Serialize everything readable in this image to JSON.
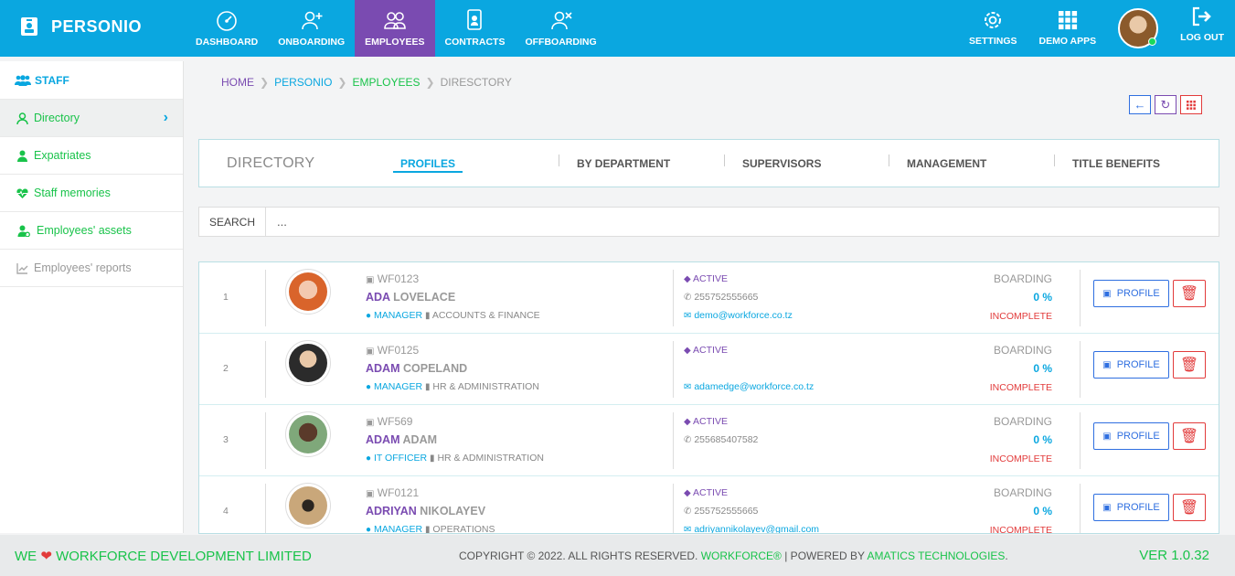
{
  "brand": {
    "name": "PERSONIO"
  },
  "nav": [
    {
      "label": "DASHBOARD"
    },
    {
      "label": "ONBOARDING"
    },
    {
      "label": "EMPLOYEES",
      "active": true
    },
    {
      "label": "CONTRACTS"
    },
    {
      "label": "OFFBOARDING"
    }
  ],
  "right_nav": {
    "settings": "SETTINGS",
    "demo_apps": "DEMO APPS",
    "logout": "LOG OUT"
  },
  "sidebar": {
    "header": "STAFF",
    "items": [
      {
        "label": "Directory",
        "active": true
      },
      {
        "label": "Expatriates"
      },
      {
        "label": "Staff memories"
      },
      {
        "label": "Employees' assets"
      },
      {
        "label": "Employees' reports"
      }
    ]
  },
  "breadcrumb": {
    "home": "HOME",
    "personio": "PERSONIO",
    "employees": "EMPLOYEES",
    "current": "DIRESCTORY"
  },
  "tabs": {
    "title": "DIRECTORY",
    "items": [
      "PROFILES",
      "BY DEPARTMENT",
      "SUPERVISORS",
      "MANAGEMENT",
      "TITLE BENEFITS"
    ]
  },
  "search": {
    "label": "SEARCH",
    "value": "..."
  },
  "employees": [
    {
      "num": "1",
      "code": "WF0123",
      "first": "ADA",
      "last": "LOVELACE",
      "title": "MANAGER",
      "dept": "ACCOUNTS & FINANCE",
      "status": "ACTIVE",
      "phone": "255752555665",
      "email": "demo@workforce.co.tz",
      "boarding": "BOARDING",
      "pct": "0 %",
      "state": "INCOMPLETE"
    },
    {
      "num": "2",
      "code": "WF0125",
      "first": "ADAM",
      "last": "COPELAND",
      "title": "MANAGER",
      "dept": "HR & ADMINISTRATION",
      "status": "ACTIVE",
      "phone": "",
      "email": "adamedge@workforce.co.tz",
      "boarding": "BOARDING",
      "pct": "0 %",
      "state": "INCOMPLETE"
    },
    {
      "num": "3",
      "code": "WF569",
      "first": "ADAM",
      "last": "ADAM",
      "title": "IT OFFICER",
      "dept": "HR & ADMINISTRATION",
      "status": "ACTIVE",
      "phone": "255685407582",
      "email": "",
      "boarding": "BOARDING",
      "pct": "0 %",
      "state": "INCOMPLETE"
    },
    {
      "num": "4",
      "code": "WF0121",
      "first": "ADRIYAN",
      "last": "NIKOLAYEV",
      "title": "MANAGER",
      "dept": "OPERATIONS",
      "status": "ACTIVE",
      "phone": "255752555665",
      "email": "adriyannikolayev@gmail.com",
      "boarding": "BOARDING",
      "pct": "0 %",
      "state": "INCOMPLETE"
    }
  ],
  "profile_button": "PROFILE",
  "footer": {
    "left_we": "WE",
    "left_company": "WORKFORCE DEVELOPMENT LIMITED",
    "copyright": "COPYRIGHT © 2022. ALL RIGHTS RESERVED.",
    "workforce": "WORKFORCE®",
    "powered": "| POWERED BY",
    "amatics": "AMATICS TECHNOLOGIES",
    "dot": ".",
    "version": "VER 1.0.32"
  },
  "colors": {
    "primary": "#0aa7e0",
    "purple": "#7a4bb1",
    "green": "#19c34a",
    "red": "#e23b3b"
  }
}
